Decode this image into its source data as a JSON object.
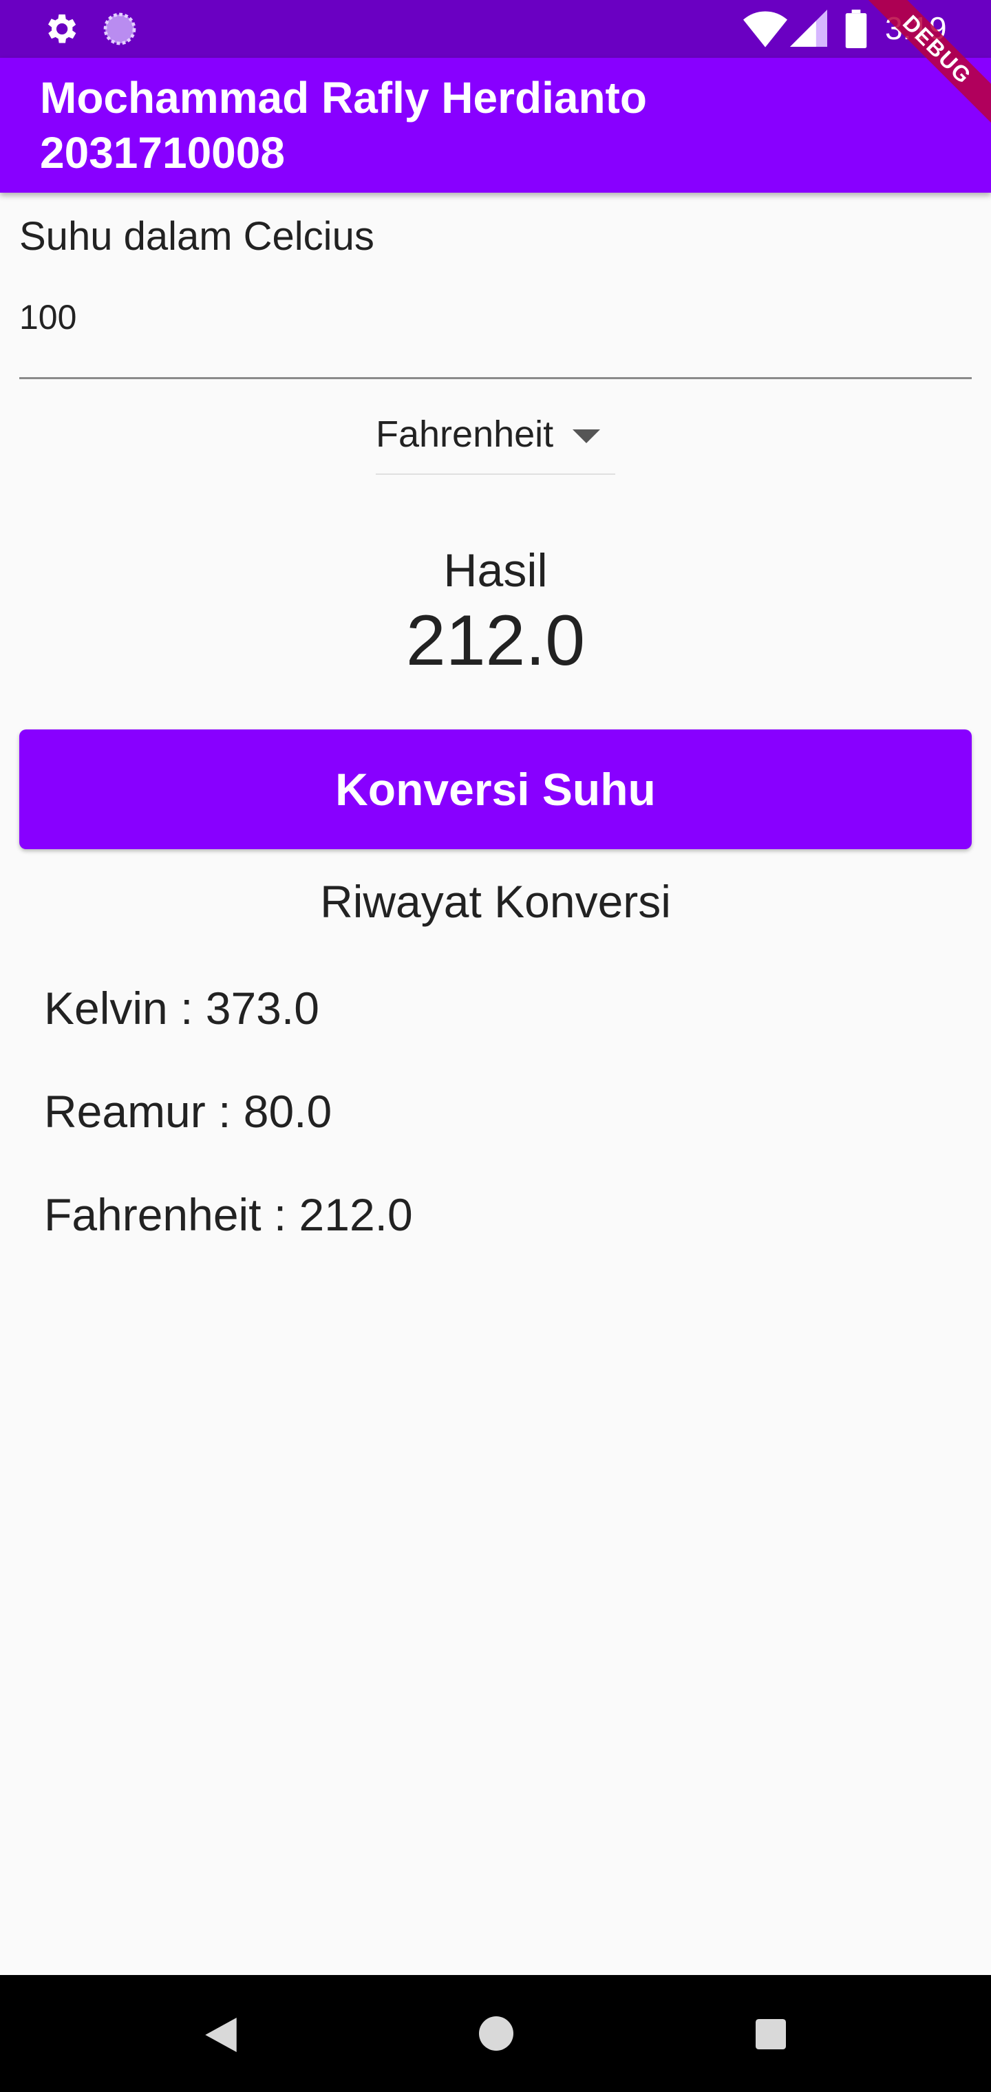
{
  "status_bar": {
    "time": "3:19",
    "left_icons": [
      "gear-icon",
      "loading-circle-icon"
    ],
    "right_icons": [
      "wifi-icon",
      "signal-icon",
      "battery-icon"
    ]
  },
  "app_bar": {
    "title_line1": "Mochammad Rafly Herdianto",
    "title_line2": "2031710008",
    "background_color": "#8800ff",
    "debug_label": "DEBUG"
  },
  "input": {
    "label": "Suhu dalam Celcius",
    "value": "100"
  },
  "dropdown": {
    "selected": "Fahrenheit"
  },
  "result": {
    "label": "Hasil",
    "value": "212.0"
  },
  "convert_button": {
    "label": "Konversi Suhu"
  },
  "history": {
    "title": "Riwayat Konversi",
    "items": [
      "Kelvin : 373.0",
      "Reamur : 80.0",
      "Fahrenheit : 212.0"
    ]
  },
  "nav_bar": {
    "buttons": [
      "back-icon",
      "home-icon",
      "recents-icon"
    ]
  }
}
